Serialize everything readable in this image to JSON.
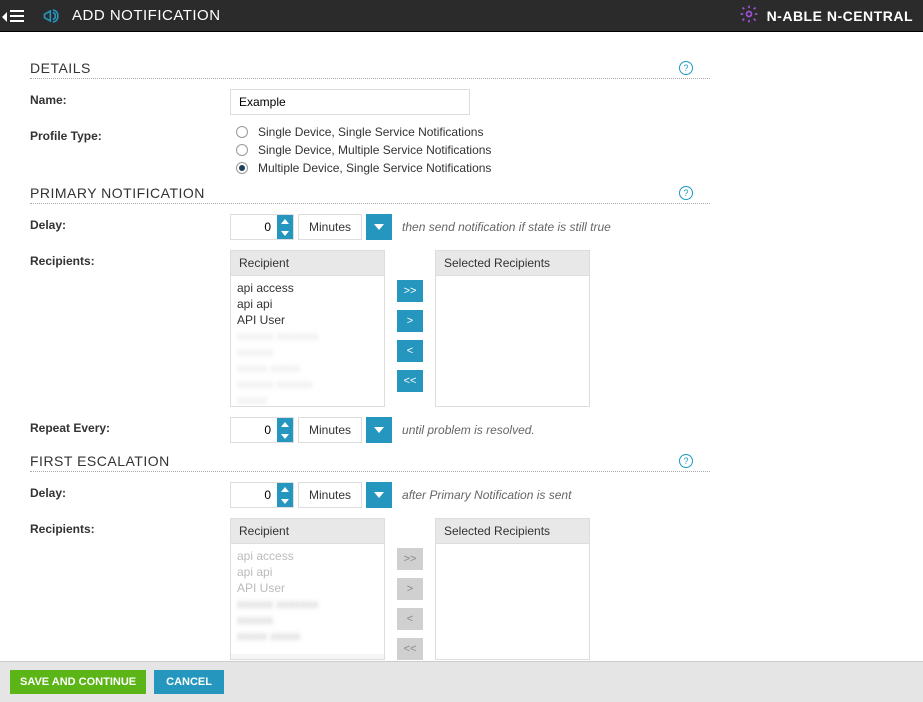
{
  "header": {
    "title": "ADD NOTIFICATION",
    "brand": "N-ABLE N-CENTRAL"
  },
  "details": {
    "section_title": "DETAILS",
    "name_label": "Name:",
    "name_value": "Example",
    "profile_type_label": "Profile Type:",
    "options": [
      "Single Device, Single Service Notifications",
      "Single Device, Multiple Service Notifications",
      "Multiple Device, Single Service Notifications"
    ]
  },
  "primary": {
    "section_title": "PRIMARY NOTIFICATION",
    "delay_label": "Delay:",
    "delay_value": "0",
    "unit": "Minutes",
    "delay_hint": "then send notification if state is still true",
    "recipients_label": "Recipients:",
    "recipient_head": "Recipient",
    "selected_head": "Selected Recipients",
    "recipients": [
      "api access",
      "api api",
      "API User"
    ],
    "repeat_label": "Repeat Every:",
    "repeat_value": "0",
    "repeat_hint": "until problem is resolved."
  },
  "escalation": {
    "section_title": "FIRST ESCALATION",
    "delay_label": "Delay:",
    "delay_value": "0",
    "unit": "Minutes",
    "delay_hint": "after Primary Notification is sent",
    "recipients_label": "Recipients:",
    "recipient_head": "Recipient",
    "selected_head": "Selected Recipients",
    "recipients": [
      "api access",
      "api api",
      "API User"
    ]
  },
  "transfer_buttons": {
    "add_all": ">>",
    "add": ">",
    "remove": "<",
    "remove_all": "<<"
  },
  "footer": {
    "save": "SAVE AND CONTINUE",
    "cancel": "CANCEL"
  }
}
